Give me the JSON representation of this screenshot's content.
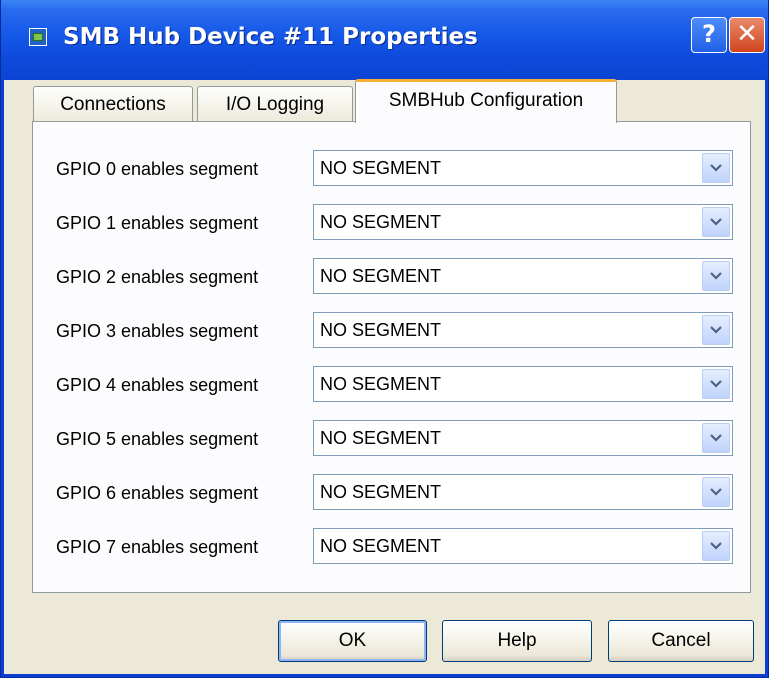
{
  "window": {
    "title": "SMB Hub Device #11 Properties",
    "help_glyph": "?",
    "close_glyph": "✕"
  },
  "tabs": [
    {
      "label": "Connections"
    },
    {
      "label": "I/O Logging"
    },
    {
      "label": "SMBHub Configuration",
      "selected": true
    }
  ],
  "gpio_rows": [
    {
      "label": "GPIO 0 enables segment",
      "value": "NO SEGMENT"
    },
    {
      "label": "GPIO 1 enables segment",
      "value": "NO SEGMENT"
    },
    {
      "label": "GPIO 2 enables segment",
      "value": "NO SEGMENT"
    },
    {
      "label": "GPIO 3 enables segment",
      "value": "NO SEGMENT"
    },
    {
      "label": "GPIO 4 enables segment",
      "value": "NO SEGMENT"
    },
    {
      "label": "GPIO 5 enables segment",
      "value": "NO SEGMENT"
    },
    {
      "label": "GPIO 6 enables segment",
      "value": "NO SEGMENT"
    },
    {
      "label": "GPIO 7 enables segment",
      "value": "NO SEGMENT"
    }
  ],
  "buttons": {
    "ok": "OK",
    "help": "Help",
    "cancel": "Cancel"
  },
  "colors": {
    "titlebar": "#0b44d2",
    "dialog_face": "#ece9d8",
    "selected_tab_accent": "#f7b035"
  }
}
